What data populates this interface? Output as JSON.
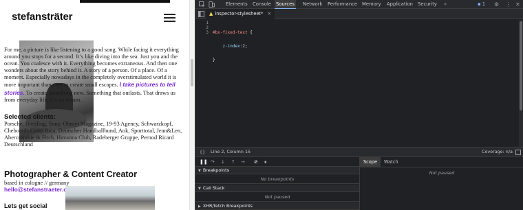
{
  "site": {
    "logo": "stefansträter",
    "intro_before": "For me, a picture is like listening to a good song. While facing it everything around you stops for a second. It’s like diving into the sea. Just you and the ocean. You coalesce with it. Everything becomes extraneous. And then one wonders about the story behind it. A story of a person. Of a place. Of a moment. Especially nowadays in the completely overstimulated world it is more important than ever to create small escapes.",
    "intro_highlight": "I take pictures to tell stories.",
    "intro_after": "To create something new. Something that outlasts. That draws us from everyday life. Let us dream.",
    "clients_heading": "Selected clients:",
    "clients_text": "Porsche, Breitling, Sony, Ohmyt Magazine, 19-93 Agency, Schwarzkopf, Cheboards Costa Rica, Deutscher Handballbund, Aok, Sporttotal, Jean&Len, Abercrombie & Fitch, Havanna Club, Radeberger Gruppe, Pernod Ricard Deutschland",
    "heading": "Photographer & Content Creator",
    "location": "based in cologne // germany",
    "email": "hello@stefanstraeter.com",
    "social_heading": "Lets get social",
    "accent_color": "#7a2bd6"
  },
  "devtools": {
    "tabs": [
      "Elements",
      "Console",
      "Sources",
      "Network",
      "Performance",
      "Memory",
      "Application",
      "Security"
    ],
    "active_tab": "Sources",
    "more_tabs": "»",
    "issues_count": "1",
    "open_file": "inspector-stylesheet*",
    "code": {
      "line_numbers": [
        "1",
        "2",
        "3"
      ],
      "line1_selector": "#bx-fixed-text",
      "line1_brace": " {",
      "line2_prop": "    z-index",
      "line2_colon": ":",
      "line2_value": "2",
      "line2_end": ";",
      "line3": "}"
    },
    "status": {
      "braces": "{}",
      "position": "Line 2, Column 15",
      "coverage": "Coverage: n/a"
    },
    "debugger": {
      "scope_tab": "Scope",
      "watch_tab": "Watch",
      "scope_not_paused": "Not paused",
      "breakpoints_title": "Breakpoints",
      "breakpoints_body": "No breakpoints",
      "callstack_title": "Call Stack",
      "callstack_body": "Not paused",
      "xhr_title": "XHR/fetch Breakpoints"
    }
  }
}
